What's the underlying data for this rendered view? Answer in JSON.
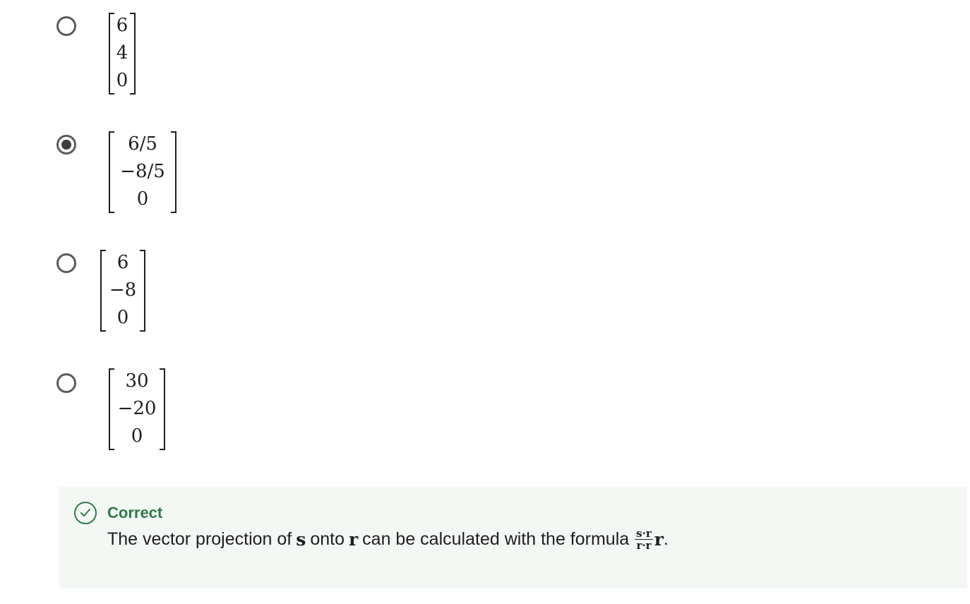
{
  "options": [
    {
      "values": [
        "6",
        "4",
        "0"
      ],
      "selected": false
    },
    {
      "values": [
        "6/5",
        "−8/5",
        "0"
      ],
      "selected": true
    },
    {
      "values": [
        "6",
        "−8",
        "0"
      ],
      "selected": false
    },
    {
      "values": [
        "30",
        "−20",
        "0"
      ],
      "selected": false
    }
  ],
  "feedback": {
    "status": "Correct",
    "text_before": "The vector projection of",
    "var_s": "s",
    "text_onto": "onto",
    "var_r": "r",
    "text_after": "can be calculated with the formula",
    "frac_num": "s·r",
    "frac_den": "r·r",
    "tail_var": "r",
    "tail_punct": ".",
    "icon": "check-circle-icon",
    "accent_color": "#2f7a4a",
    "background_color": "#f4f8f4"
  }
}
